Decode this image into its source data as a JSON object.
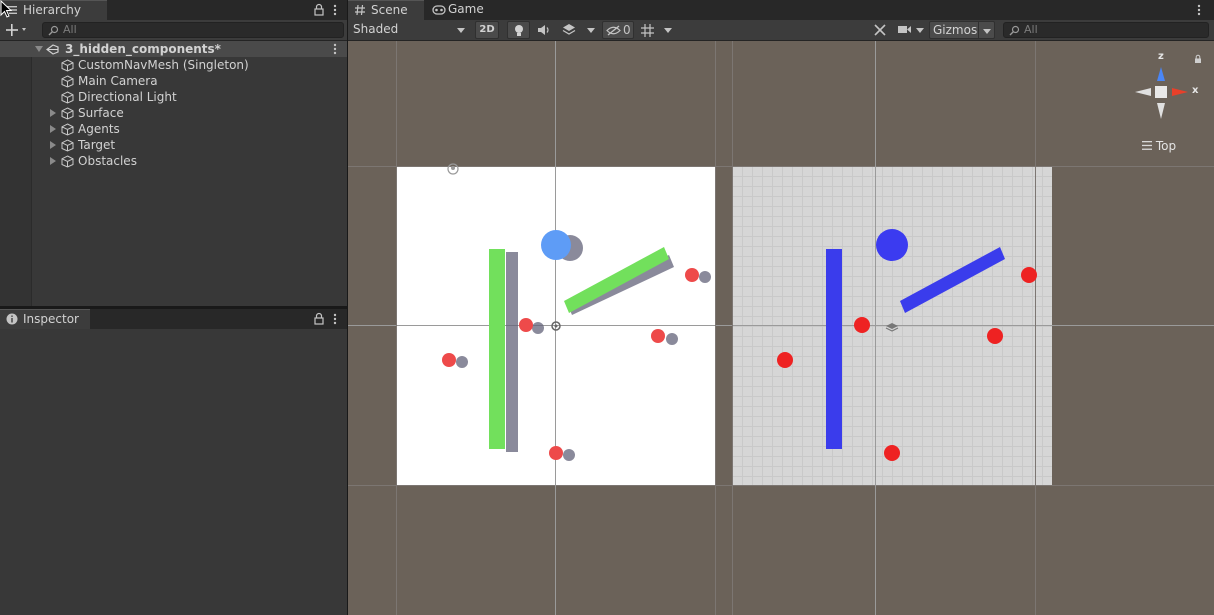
{
  "hierarchy": {
    "tab_label": "Hierarchy",
    "search_placeholder": "All",
    "scene_name": "3_hidden_components*",
    "items": [
      {
        "label": "CustomNavMesh (Singleton)",
        "expandable": false
      },
      {
        "label": "Main Camera",
        "expandable": false
      },
      {
        "label": "Directional Light",
        "expandable": false
      },
      {
        "label": "Surface",
        "expandable": true
      },
      {
        "label": "Agents",
        "expandable": true
      },
      {
        "label": "Target",
        "expandable": true
      },
      {
        "label": "Obstacles",
        "expandable": true
      }
    ]
  },
  "inspector": {
    "tab_label": "Inspector"
  },
  "scene_view": {
    "tabs": [
      {
        "label": "Scene",
        "icon": "hash-icon",
        "active": true
      },
      {
        "label": "Game",
        "icon": "gamepad-icon",
        "active": false
      }
    ],
    "draw_mode": "Shaded",
    "mode_2d_label": "2D",
    "hidden_count": "0",
    "gizmos_label": "Gizmos",
    "search_placeholder": "All",
    "orientation_label": "Top",
    "axis_labels": {
      "z": "z",
      "x": "x"
    }
  },
  "colors": {
    "viewport_bg": "#6b6259",
    "floor_lit": "#ffffff",
    "floor_grid": "#d6d6d6",
    "obstacle_green": "#72e05c",
    "obstacle_blue": "#3a3cec",
    "agent_red": "#ee4a4a",
    "agent_red_bright": "#ee2222",
    "target_lightblue": "#5e9cf6",
    "target_blue": "#3b3bf0",
    "axis_x": "#e8402a",
    "axis_y": "#4a86f6"
  }
}
